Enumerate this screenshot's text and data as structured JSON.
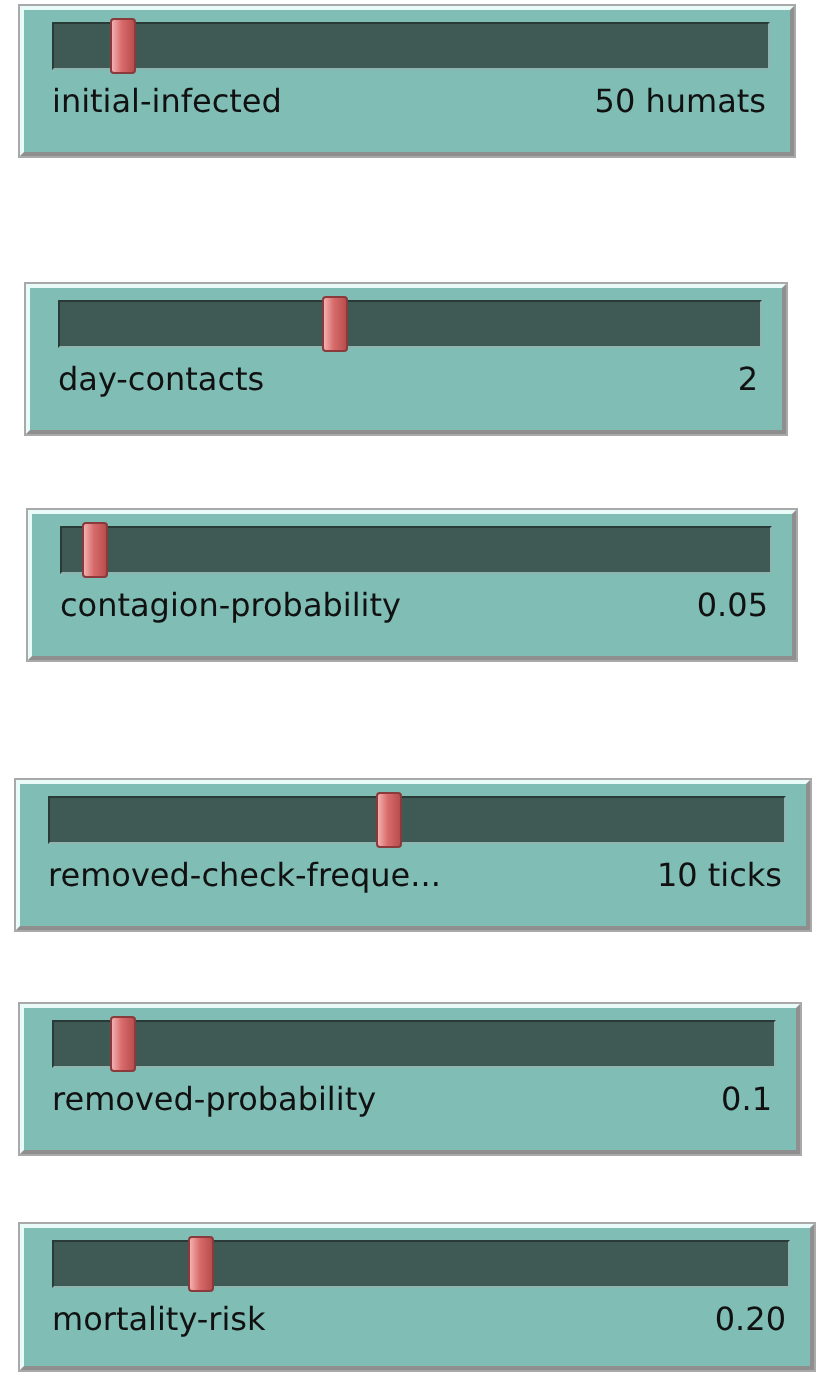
{
  "sliders": [
    {
      "label": "initial-infected",
      "reading": "50 humats",
      "level": 0.08
    },
    {
      "label": "day-contacts",
      "reading": "2",
      "level": 0.39
    },
    {
      "label": "contagion-probability",
      "reading": "0.05",
      "level": 0.03
    },
    {
      "label": "removed-check-freque...",
      "reading": "10 ticks",
      "level": 0.46
    },
    {
      "label": "removed-probability",
      "reading": "0.1",
      "level": 0.08
    },
    {
      "label": "mortality-risk",
      "reading": "0.20",
      "level": 0.19
    }
  ]
}
